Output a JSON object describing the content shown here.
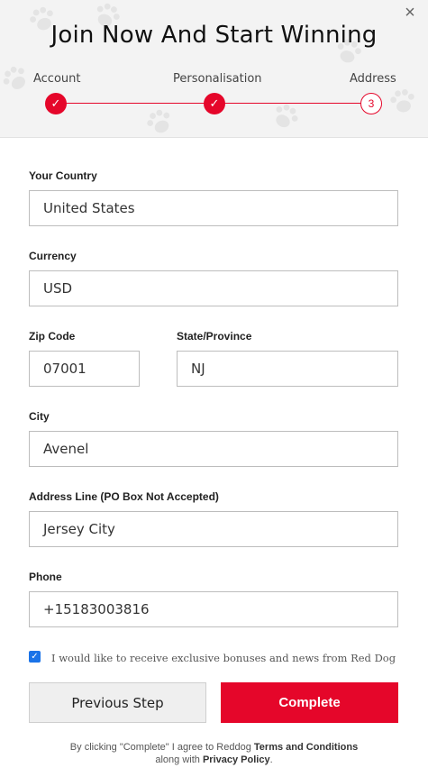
{
  "header": {
    "title": "Join Now And Start Winning",
    "close_icon": "×"
  },
  "stepper": {
    "steps": [
      {
        "label": "Account",
        "state": "done",
        "marker": "✓"
      },
      {
        "label": "Personalisation",
        "state": "done",
        "marker": "✓"
      },
      {
        "label": "Address",
        "state": "current",
        "marker": "3"
      }
    ],
    "accent_color": "#e5062a"
  },
  "form": {
    "country": {
      "label": "Your Country",
      "value": "United States"
    },
    "currency": {
      "label": "Currency",
      "value": "USD"
    },
    "zip": {
      "label": "Zip Code",
      "value": "07001"
    },
    "state": {
      "label": "State/Province",
      "value": "NJ"
    },
    "city": {
      "label": "City",
      "value": "Avenel"
    },
    "address": {
      "label": "Address Line (PO Box Not Accepted)",
      "value": "Jersey City"
    },
    "phone": {
      "label": "Phone",
      "value": "+15183003816"
    }
  },
  "consent": {
    "checked": true,
    "check_mark": "✓",
    "text": "I would like to receive exclusive bonuses and news from Red Dog"
  },
  "buttons": {
    "previous": "Previous Step",
    "complete": "Complete"
  },
  "legal": {
    "prefix": "By clicking \"Complete\" I agree to Reddog ",
    "terms": "Terms and Conditions",
    "middle": "along with ",
    "privacy": "Privacy Policy",
    "suffix": "."
  },
  "colors": {
    "brand_red": "#e5062a",
    "checkbox_blue": "#1a73e8",
    "header_bg": "#f3f3f3"
  },
  "icons": {
    "close": "close-icon",
    "background": "paw-print-icon",
    "step_done": "checkmark-icon"
  }
}
